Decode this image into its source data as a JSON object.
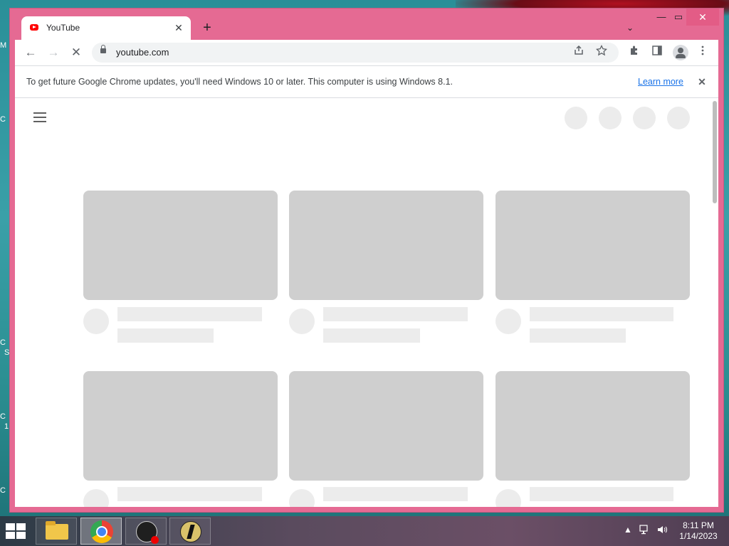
{
  "browser": {
    "tab": {
      "title": "YouTube",
      "close": "✕"
    },
    "new_tab": "+",
    "tab_search": "⌄",
    "window_controls": {
      "minimize": "—",
      "maximize": "▭",
      "close": "✕"
    },
    "nav": {
      "back": "←",
      "forward": "→",
      "stop": "✕"
    },
    "address": {
      "url": "youtube.com"
    },
    "icons": [
      "share-icon",
      "star-icon",
      "extensions-icon",
      "side-panel-icon",
      "profile-icon",
      "menu-icon"
    ]
  },
  "infobar": {
    "message": "To get future Google Chrome updates, you'll need Windows 10 or later. This computer is using Windows 8.1.",
    "link": "Learn more",
    "close": "✕"
  },
  "desktop": {
    "fragments": [
      "M",
      "C",
      "C",
      "S",
      "C",
      "1",
      "C"
    ]
  },
  "taskbar": {
    "apps": [
      "file-explorer",
      "google-chrome",
      "obs-studio",
      "counter-strike"
    ],
    "time": "8:11 PM",
    "date": "1/14/2023"
  }
}
